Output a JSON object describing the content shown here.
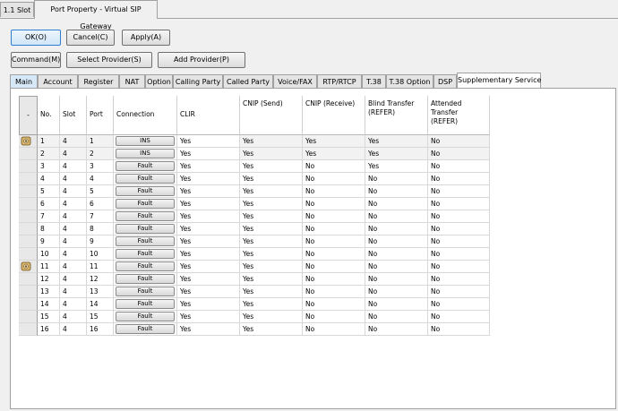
{
  "top_tabs": [
    "1.1 Slot",
    "Port Property - Virtual SIP Gateway"
  ],
  "buttons": {
    "ok": "OK(O)",
    "cancel": "Cancel(C)",
    "apply": "Apply(A)",
    "command": "Command(M)",
    "select_provider": "Select Provider(S)",
    "add_provider": "Add Provider(P)"
  },
  "sub_tabs": [
    "Main",
    "Account",
    "Register",
    "NAT",
    "Option",
    "Calling Party",
    "Called Party",
    "Voice/FAX",
    "RTP/RTCP",
    "T.38",
    "T.38 Option",
    "DSP",
    "Supplementary Service"
  ],
  "active_sub_tab": "Supplementary Service",
  "grid": {
    "corner": "-",
    "headers": [
      {
        "key": "no",
        "label": "No."
      },
      {
        "key": "slot",
        "label": "Slot"
      },
      {
        "key": "port",
        "label": "Port"
      },
      {
        "key": "conn",
        "label": "Connection"
      },
      {
        "key": "clir",
        "label": "CLIR"
      },
      {
        "key": "cnip_send",
        "label": "CNIP (Send)"
      },
      {
        "key": "cnip_recv",
        "label": "CNIP (Receive)"
      },
      {
        "key": "blind",
        "label": "Blind Transfer (REFER)"
      },
      {
        "key": "attended",
        "label": "Attended Transfer (REFER)"
      }
    ],
    "rows": [
      {
        "no": "1",
        "slot": "4",
        "port": "1",
        "conn": "INS",
        "clir": "Yes",
        "cnip_send": "Yes",
        "cnip_recv": "Yes",
        "blind": "Yes",
        "attended": "No",
        "icon": true
      },
      {
        "no": "2",
        "slot": "4",
        "port": "2",
        "conn": "INS",
        "clir": "Yes",
        "cnip_send": "Yes",
        "cnip_recv": "Yes",
        "blind": "Yes",
        "attended": "No",
        "icon": false
      },
      {
        "no": "3",
        "slot": "4",
        "port": "3",
        "conn": "Fault",
        "clir": "Yes",
        "cnip_send": "Yes",
        "cnip_recv": "No",
        "blind": "Yes",
        "attended": "No",
        "icon": false
      },
      {
        "no": "4",
        "slot": "4",
        "port": "4",
        "conn": "Fault",
        "clir": "Yes",
        "cnip_send": "Yes",
        "cnip_recv": "No",
        "blind": "No",
        "attended": "No",
        "icon": false
      },
      {
        "no": "5",
        "slot": "4",
        "port": "5",
        "conn": "Fault",
        "clir": "Yes",
        "cnip_send": "Yes",
        "cnip_recv": "No",
        "blind": "No",
        "attended": "No",
        "icon": false
      },
      {
        "no": "6",
        "slot": "4",
        "port": "6",
        "conn": "Fault",
        "clir": "Yes",
        "cnip_send": "Yes",
        "cnip_recv": "No",
        "blind": "No",
        "attended": "No",
        "icon": false
      },
      {
        "no": "7",
        "slot": "4",
        "port": "7",
        "conn": "Fault",
        "clir": "Yes",
        "cnip_send": "Yes",
        "cnip_recv": "No",
        "blind": "No",
        "attended": "No",
        "icon": false
      },
      {
        "no": "8",
        "slot": "4",
        "port": "8",
        "conn": "Fault",
        "clir": "Yes",
        "cnip_send": "Yes",
        "cnip_recv": "No",
        "blind": "No",
        "attended": "No",
        "icon": false
      },
      {
        "no": "9",
        "slot": "4",
        "port": "9",
        "conn": "Fault",
        "clir": "Yes",
        "cnip_send": "Yes",
        "cnip_recv": "No",
        "blind": "No",
        "attended": "No",
        "icon": false
      },
      {
        "no": "10",
        "slot": "4",
        "port": "10",
        "conn": "Fault",
        "clir": "Yes",
        "cnip_send": "Yes",
        "cnip_recv": "No",
        "blind": "No",
        "attended": "No",
        "icon": false
      },
      {
        "no": "11",
        "slot": "4",
        "port": "11",
        "conn": "Fault",
        "clir": "Yes",
        "cnip_send": "Yes",
        "cnip_recv": "No",
        "blind": "No",
        "attended": "No",
        "icon": true
      },
      {
        "no": "12",
        "slot": "4",
        "port": "12",
        "conn": "Fault",
        "clir": "Yes",
        "cnip_send": "Yes",
        "cnip_recv": "No",
        "blind": "No",
        "attended": "No",
        "icon": false
      },
      {
        "no": "13",
        "slot": "4",
        "port": "13",
        "conn": "Fault",
        "clir": "Yes",
        "cnip_send": "Yes",
        "cnip_recv": "No",
        "blind": "No",
        "attended": "No",
        "icon": false
      },
      {
        "no": "14",
        "slot": "4",
        "port": "14",
        "conn": "Fault",
        "clir": "Yes",
        "cnip_send": "Yes",
        "cnip_recv": "No",
        "blind": "No",
        "attended": "No",
        "icon": false
      },
      {
        "no": "15",
        "slot": "4",
        "port": "15",
        "conn": "Fault",
        "clir": "Yes",
        "cnip_send": "Yes",
        "cnip_recv": "No",
        "blind": "No",
        "attended": "No",
        "icon": false
      },
      {
        "no": "16",
        "slot": "4",
        "port": "16",
        "conn": "Fault",
        "clir": "Yes",
        "cnip_send": "Yes",
        "cnip_recv": "No",
        "blind": "No",
        "attended": "No",
        "icon": false
      }
    ]
  }
}
